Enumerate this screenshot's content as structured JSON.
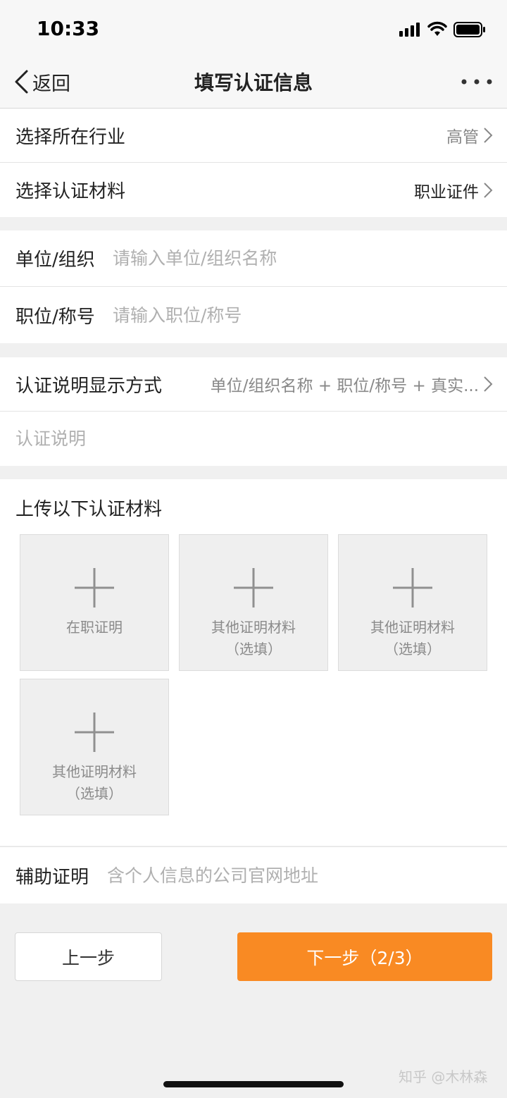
{
  "status_bar": {
    "time": "10:33"
  },
  "nav": {
    "back_label": "返回",
    "title": "填写认证信息"
  },
  "industry": {
    "label": "选择所在行业",
    "value": "高管"
  },
  "material_type": {
    "label": "选择认证材料",
    "value": "职业证件"
  },
  "organization": {
    "label": "单位/组织",
    "placeholder": "请输入单位/组织名称"
  },
  "position": {
    "label": "职位/称号",
    "placeholder": "请输入职位/称号"
  },
  "display_mode": {
    "label": "认证说明显示方式",
    "value": "单位/组织名称 + 职位/称号 + 真实..."
  },
  "description": {
    "placeholder": "认证说明"
  },
  "upload": {
    "title": "上传以下认证材料",
    "tiles": [
      {
        "line1": "在职证明",
        "line2": ""
      },
      {
        "line1": "其他证明材料",
        "line2": "（选填）"
      },
      {
        "line1": "其他证明材料",
        "line2": "（选填）"
      },
      {
        "line1": "其他证明材料",
        "line2": "（选填）"
      }
    ]
  },
  "auxiliary": {
    "label": "辅助证明",
    "placeholder": "含个人信息的公司官网地址"
  },
  "buttons": {
    "prev": "上一步",
    "next": "下一步（2/3）"
  },
  "colors": {
    "accent": "#f98a23",
    "background": "#f0f0f0"
  },
  "watermark": "知乎 @木林森"
}
